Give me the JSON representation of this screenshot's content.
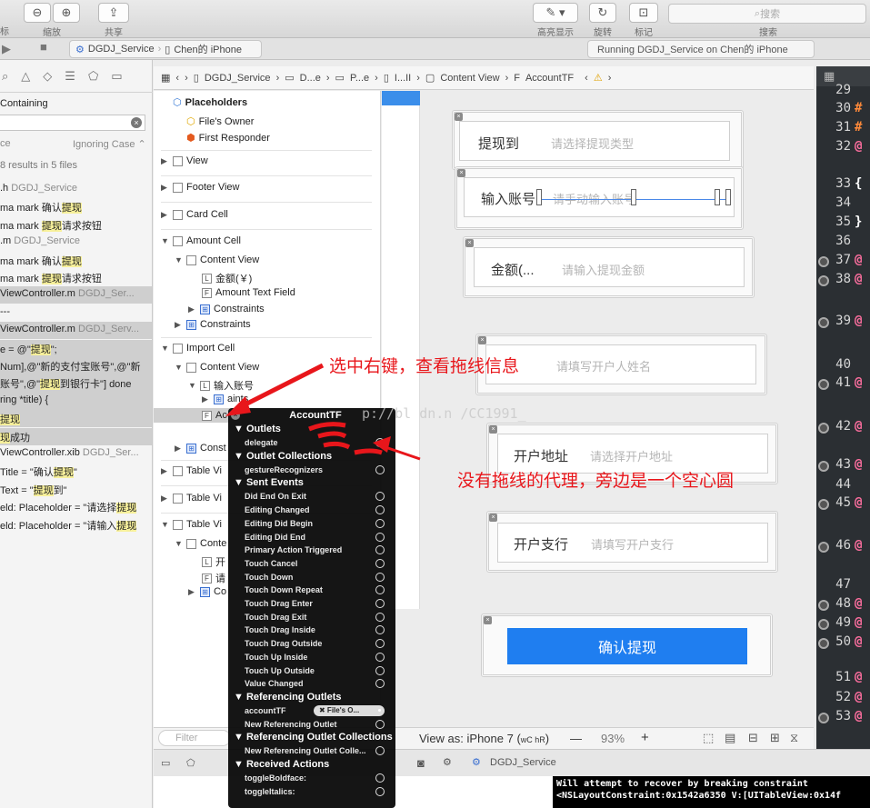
{
  "toolbar": {
    "zoom_label": "缩放",
    "share_label": "共享",
    "highlight_label": "高亮显示",
    "rotate_label": "旋转",
    "mark_label": "标记",
    "search_placeholder": "搜索",
    "search_label": "搜索",
    "left_cut_label": "标"
  },
  "scheme": {
    "project": "DGDJ_Service",
    "device": "Chen的 iPhone",
    "status": "Running DGDJ_Service on Chen的 iPhone"
  },
  "navigator": {
    "containing": "Containing",
    "match_left": "ce",
    "ignoring_case": "Ignoring Case",
    "results": "8 results in 5 files",
    "lines": [
      {
        "a": ".h ",
        "b": "DGDJ_Service",
        "c": "",
        "file": true
      },
      {
        "a": "ma mark 确认",
        "b": "提现",
        "c": "",
        "file": false
      },
      {
        "a": "ma mark ",
        "b": "提现",
        "c": "请求按钮",
        "file": false
      },
      {
        "a": ".m ",
        "b": "DGDJ_Service",
        "c": "",
        "file": true
      },
      {
        "a": "ma mark 确认",
        "b": "提现",
        "c": "",
        "file": false
      },
      {
        "a": "ma mark ",
        "b": "提现",
        "c": "请求按钮",
        "file": false
      },
      {
        "a": "ViewController.m ",
        "b": "DGDJ_Ser...",
        "c": "",
        "file": true
      },
      {
        "a": "---",
        "b": "",
        "c": "",
        "file": false
      },
      {
        "a": "ViewController.m ",
        "b": "DGDJ_Serv...",
        "c": "",
        "file": true
      },
      {
        "a": "e = @\"",
        "b": "提现",
        "c": "\";",
        "file": false
      },
      {
        "a": "Num],@\"新的支付宝账号\",@\"新",
        "b": "",
        "c": "",
        "file": false
      },
      {
        "a": "账号\",@\"",
        "b": "提现",
        "c": "到银行卡\"] done",
        "file": false
      },
      {
        "a": "ring *title) {",
        "b": "",
        "c": "",
        "file": false
      },
      {
        "a": "",
        "b": "提现",
        "c": "",
        "file": false
      },
      {
        "a": "",
        "b": "现",
        "c": "成功",
        "file": false
      },
      {
        "a": "ViewController.xib ",
        "b": "DGDJ_Ser...",
        "c": "",
        "file": true
      },
      {
        "a": " Title = \"确认",
        "b": "提现",
        "c": "\"",
        "file": false
      },
      {
        "a": "Text = \"",
        "b": "提现",
        "c": "到\"",
        "file": false
      },
      {
        "a": "eld: Placeholder = \"请选择",
        "b": "提现",
        "c": "",
        "file": false
      },
      {
        "a": "eld: Placeholder = \"请输入",
        "b": "提现",
        "c": "",
        "file": false
      }
    ]
  },
  "jumpbar": [
    "DGDJ_Service",
    "D...e",
    "P...e",
    "I...II",
    "Content View",
    "AccountTF"
  ],
  "outline": {
    "placeholders": "Placeholders",
    "files_owner": "File's Owner",
    "first_responder": "First Responder",
    "view": "View",
    "footer_view": "Footer View",
    "card_cell": "Card Cell",
    "amount_cell": "Amount Cell",
    "content_view": "Content View",
    "amount_label": "金额(￥)",
    "amount_text_field": "Amount Text Field",
    "constraints": "Constraints",
    "import_cell": "Import Cell",
    "content_view_2": "Content View",
    "input_label": "输入账号",
    "aints": "aints",
    "ac": "Ac",
    "cons": "Const",
    "table_vi_1": "Table Vi",
    "table_vi_2": "Table Vi",
    "table_vi_3": "Table Vi",
    "conte": "Conte",
    "kai": "开",
    "qing": "请",
    "co": "Co"
  },
  "canvas": {
    "cells": [
      {
        "label": "提现到",
        "placeholder": "请选择提现类型"
      },
      {
        "label": "输入账号",
        "placeholder": "请手动输入账号"
      },
      {
        "label": "金额(...",
        "placeholder": "请输入提现金额"
      },
      {
        "label": "",
        "placeholder": "请填写开户人姓名"
      },
      {
        "label": "开户地址",
        "placeholder": "请选择开户地址"
      },
      {
        "label": "开户支行",
        "placeholder": "请填写开户支行"
      }
    ],
    "confirm_button": "确认提现"
  },
  "bottombar": {
    "filter_placeholder": "Filter",
    "view_as": "View as: iPhone 7 (",
    "size_class": "wC hR",
    "view_as_end": ")",
    "zoom": "93%",
    "minus": "—",
    "plus": "+"
  },
  "debug": {
    "target": "DGDJ_Service"
  },
  "console": [
    "Will attempt to recover by breaking constraint",
    "<NSLayoutConstraint:0x1542a6350 V:[UITableView:0x14f"
  ],
  "code_lines": [
    {
      "n": "29",
      "t": "",
      "c": "#ffd86b"
    },
    {
      "n": "30",
      "t": "#",
      "c": "#ff8a3a"
    },
    {
      "n": "31",
      "t": "#",
      "c": "#ff8a3a"
    },
    {
      "n": "32",
      "t": "@",
      "c": "#ff6fa0"
    },
    {
      "n": "33",
      "t": "{",
      "c": "#ffffff"
    },
    {
      "n": "34",
      "t": "",
      "c": "#ffffff"
    },
    {
      "n": "35",
      "t": "}",
      "c": "#ffffff"
    },
    {
      "n": "36",
      "t": "",
      "c": "#ffffff"
    },
    {
      "n": "37",
      "t": "@",
      "c": "#ff6fa0"
    },
    {
      "n": "38",
      "t": "@",
      "c": "#ff6fa0"
    },
    {
      "n": "39",
      "t": "@",
      "c": "#ff6fa0"
    },
    {
      "n": "40",
      "t": "",
      "c": "#ffffff"
    },
    {
      "n": "41",
      "t": "@",
      "c": "#ff6fa0"
    },
    {
      "n": "42",
      "t": "@",
      "c": "#ff6fa0"
    },
    {
      "n": "43",
      "t": "@",
      "c": "#ff6fa0"
    },
    {
      "n": "44",
      "t": "",
      "c": "#ffffff"
    },
    {
      "n": "45",
      "t": "@",
      "c": "#ff6fa0"
    },
    {
      "n": "46",
      "t": "@",
      "c": "#ff6fa0"
    },
    {
      "n": "47",
      "t": "",
      "c": "#ffffff"
    },
    {
      "n": "48",
      "t": "@",
      "c": "#ff6fa0"
    },
    {
      "n": "49",
      "t": "@",
      "c": "#ff6fa0"
    },
    {
      "n": "50",
      "t": "@",
      "c": "#ff6fa0"
    },
    {
      "n": "51",
      "t": "@",
      "c": "#ff6fa0"
    },
    {
      "n": "52",
      "t": "@",
      "c": "#ff6fa0"
    },
    {
      "n": "53",
      "t": "@",
      "c": "#ff6fa0"
    }
  ],
  "popup": {
    "title": "AccountTF",
    "outlets": "Outlets",
    "delegate": "delegate",
    "outlet_collections": "Outlet Collections",
    "gesture": "gestureRecognizers",
    "sent_events": "Sent Events",
    "events": [
      "Did End On Exit",
      "Editing Changed",
      "Editing Did Begin",
      "Editing Did End",
      "Primary Action Triggered",
      "Touch Cancel",
      "Touch Down",
      "Touch Down Repeat",
      "Touch Drag Enter",
      "Touch Drag Exit",
      "Touch Drag Inside",
      "Touch Drag Outside",
      "Touch Up Inside",
      "Touch Up Outside",
      "Value Changed"
    ],
    "referencing_outlets": "Referencing Outlets",
    "account_tf": "accountTF",
    "files_owner_conn": "✖ File's O...",
    "new_ref_outlet": "New Referencing Outlet",
    "ref_outlet_collections": "Referencing Outlet Collections",
    "new_ref_outlet_coll": "New Referencing Outlet Colle...",
    "received_actions": "Received Actions",
    "toggle_bold": "toggleBoldface:",
    "toggle_italics": "toggleItalics:"
  },
  "annotations": {
    "top": "选中右键，查看拖线信息",
    "bottom": "没有拖线的代理，旁边是一个空心圆"
  },
  "watermark": "p://bl    dn.n    /CC1991_",
  "colors": {
    "accent": "#1f7ef0",
    "annotation": "#e8161b",
    "highlight": "#f7f09b"
  }
}
